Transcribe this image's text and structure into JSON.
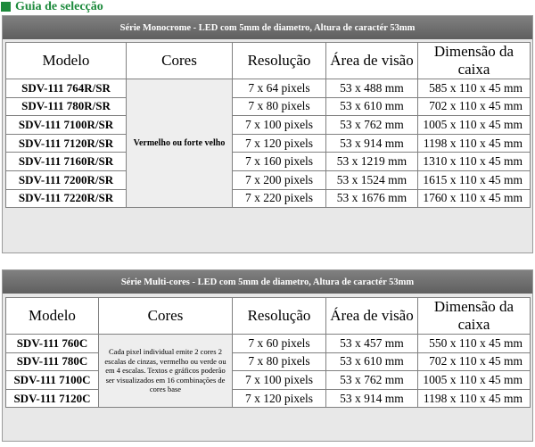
{
  "title": "Guia de selecção",
  "tables": [
    {
      "header": "Série Monocrome - LED com 5mm de diametro, Altura de caractér 53mm",
      "columns": [
        "Modelo",
        "Cores",
        "Resolução",
        "Área de visão",
        "Dimensão da caixa"
      ],
      "cores_note": "Vermelho ou forte velho",
      "rows": [
        {
          "modelo": "SDV-111 764R/SR",
          "resolucao": "7 x 64 pixels",
          "area": "53 x 488 mm",
          "dimensao": "585 x 110 x 45 mm"
        },
        {
          "modelo": "SDV-111 780R/SR",
          "resolucao": "7 x 80 pixels",
          "area": "53 x 610 mm",
          "dimensao": "702 x 110 x 45 mm"
        },
        {
          "modelo": "SDV-111 7100R/SR",
          "resolucao": "7 x 100 pixels",
          "area": "53 x 762 mm",
          "dimensao": "1005 x 110 x 45 mm"
        },
        {
          "modelo": "SDV-111 7120R/SR",
          "resolucao": "7 x 120 pixels",
          "area": "53 x 914 mm",
          "dimensao": "1198 x 110 x 45 mm"
        },
        {
          "modelo": "SDV-111 7160R/SR",
          "resolucao": "7 x 160 pixels",
          "area": "53 x 1219 mm",
          "dimensao": "1310 x 110 x 45 mm"
        },
        {
          "modelo": "SDV-111 7200R/SR",
          "resolucao": "7 x 200 pixels",
          "area": "53 x 1524 mm",
          "dimensao": "1615 x 110 x 45 mm"
        },
        {
          "modelo": "SDV-111 7220R/SR",
          "resolucao": "7 x 220 pixels",
          "area": "53 x 1676 mm",
          "dimensao": "1760 x 110 x 45 mm"
        }
      ]
    },
    {
      "header": "Série Multi-cores - LED com 5mm de diametro, Altura de caractér 53mm",
      "columns": [
        "Modelo",
        "Cores",
        "Resolução",
        "Área de visão",
        "Dimensão da caixa"
      ],
      "cores_note": "Cada pixel individual emite 2 cores 2 escalas de cinzas, vermelho ou verde ou em 4 escalas. Textos e gráficos poderão ser visualizados em 16 combinações de cores base",
      "rows": [
        {
          "modelo": "SDV-111 760C",
          "resolucao": "7 x 60 pixels",
          "area": "53 x 457 mm",
          "dimensao": "550 x 110 x 45 mm"
        },
        {
          "modelo": "SDV-111 780C",
          "resolucao": "7 x 80 pixels",
          "area": "53 x 610 mm",
          "dimensao": "702 x 110 x 45 mm"
        },
        {
          "modelo": "SDV-111 7100C",
          "resolucao": "7 x 100 pixels",
          "area": "53 x 762 mm",
          "dimensao": "1005 x 110 x 45 mm"
        },
        {
          "modelo": "SDV-111 7120C",
          "resolucao": "7 x 120 pixels",
          "area": "53 x 914 mm",
          "dimensao": "1198 x 110 x 45 mm"
        }
      ]
    }
  ]
}
